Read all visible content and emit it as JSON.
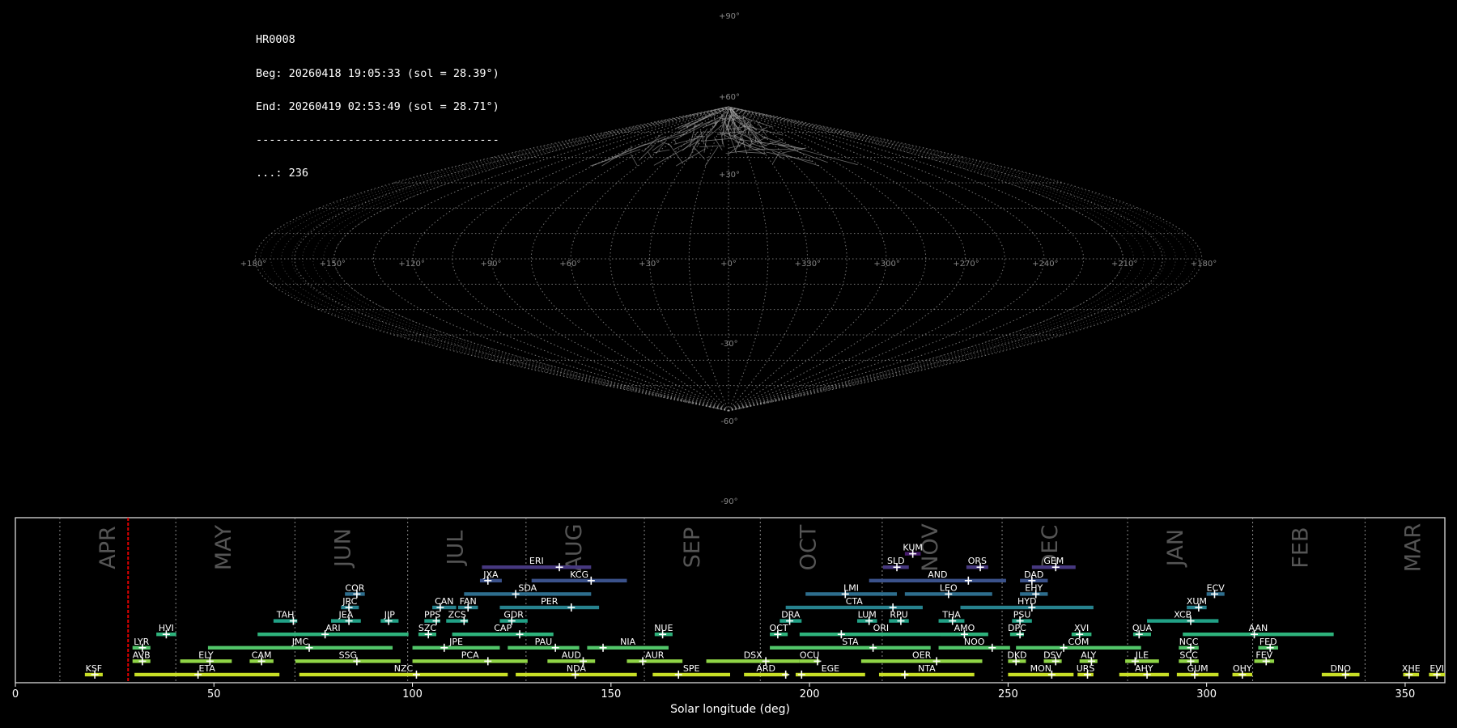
{
  "header": {
    "station": "HR0008",
    "begin": "Beg: 20260418 19:05:33 (sol = 28.39°)",
    "end": "End: 20260419 02:53:49 (sol = 28.71°)",
    "separator": "-------------------------------------",
    "count": "...: 236"
  },
  "sky_map": {
    "projection": "sinusoidal",
    "lon_labels": [
      "+180°",
      "+150°",
      "+120°",
      "+90°",
      "+60°",
      "+30°",
      "+0°",
      "+330°",
      "+300°",
      "+270°",
      "+240°",
      "+210°",
      "+180°"
    ],
    "lat_labels": [
      "+90°",
      "+60°",
      "+30°",
      "-30°",
      "-60°",
      "-90°"
    ],
    "grid_color": "#9a9a9a",
    "meteors_visible": true
  },
  "chart_data": {
    "type": "gantt",
    "xlabel": "Solar longitude (deg)",
    "xlim": [
      0,
      360
    ],
    "xticks": [
      0,
      50,
      100,
      150,
      200,
      250,
      300,
      350
    ],
    "current_sol": 28.39,
    "months": [
      {
        "name": "APR",
        "start": 11.2
      },
      {
        "name": "MAY",
        "start": 40.4
      },
      {
        "name": "JUN",
        "start": 70.4
      },
      {
        "name": "JUL",
        "start": 98.8
      },
      {
        "name": "AUG",
        "start": 128.6
      },
      {
        "name": "SEP",
        "start": 158.4
      },
      {
        "name": "OCT",
        "start": 187.6
      },
      {
        "name": "NOV",
        "start": 218.3
      },
      {
        "name": "DEC",
        "start": 248.5
      },
      {
        "name": "JAN",
        "start": 280.1
      },
      {
        "name": "FEB",
        "start": 311.6
      },
      {
        "name": "MAR",
        "start": 339.9
      }
    ],
    "showers": [
      {
        "code": "KSF",
        "start": 17.5,
        "end": 22,
        "peak": 20,
        "row": 0
      },
      {
        "code": "ETA",
        "start": 30,
        "end": 66.5,
        "peak": 46,
        "row": 0
      },
      {
        "code": "NZC",
        "start": 71.5,
        "end": 124,
        "peak": 101,
        "row": 0
      },
      {
        "code": "NDA",
        "start": 126,
        "end": 156.5,
        "peak": 141,
        "row": 0
      },
      {
        "code": "SPE",
        "start": 160.5,
        "end": 180,
        "peak": 167,
        "row": 0
      },
      {
        "code": "ARD",
        "start": 183.5,
        "end": 194.5,
        "peak": 194,
        "row": 0
      },
      {
        "code": "EGE",
        "start": 196.5,
        "end": 214,
        "peak": 198,
        "row": 0
      },
      {
        "code": "NTA",
        "start": 217.5,
        "end": 241.5,
        "peak": 224,
        "row": 0
      },
      {
        "code": "MON",
        "start": 250,
        "end": 266.5,
        "peak": 261,
        "row": 0
      },
      {
        "code": "URS",
        "start": 267.5,
        "end": 271.5,
        "peak": 270,
        "row": 0
      },
      {
        "code": "AHY",
        "start": 278,
        "end": 290.5,
        "peak": 285,
        "row": 0
      },
      {
        "code": "GUM",
        "start": 292.5,
        "end": 303,
        "peak": 297,
        "row": 0
      },
      {
        "code": "OHY",
        "start": 306.5,
        "end": 311.5,
        "peak": 309,
        "row": 0
      },
      {
        "code": "DNO",
        "start": 329,
        "end": 338.5,
        "peak": 335,
        "row": 0
      },
      {
        "code": "XHE",
        "start": 349.5,
        "end": 353.5,
        "peak": 351,
        "row": 0
      },
      {
        "code": "EVI",
        "start": 356,
        "end": 360,
        "peak": 358,
        "row": 0
      },
      {
        "code": "AVB",
        "start": 29.5,
        "end": 34,
        "peak": 32,
        "row": 1
      },
      {
        "code": "ELY",
        "start": 41.5,
        "end": 54.5,
        "peak": 49,
        "row": 1
      },
      {
        "code": "CAM",
        "start": 59,
        "end": 65,
        "peak": 62,
        "row": 1
      },
      {
        "code": "SSG",
        "start": 70.5,
        "end": 97,
        "peak": 86,
        "row": 1
      },
      {
        "code": "PCA",
        "start": 100,
        "end": 129,
        "peak": 119,
        "row": 1
      },
      {
        "code": "AUD",
        "start": 134,
        "end": 146,
        "peak": 143,
        "row": 1
      },
      {
        "code": "AUR",
        "start": 154,
        "end": 168,
        "peak": 158,
        "row": 1
      },
      {
        "code": "DSX",
        "start": 174,
        "end": 197.5,
        "peak": 189,
        "row": 1
      },
      {
        "code": "OCU",
        "start": 197.5,
        "end": 202.5,
        "peak": 202,
        "row": 1
      },
      {
        "code": "OER",
        "start": 213,
        "end": 243.5,
        "peak": 232,
        "row": 1
      },
      {
        "code": "DKD",
        "start": 250,
        "end": 254.5,
        "peak": 252,
        "row": 1
      },
      {
        "code": "DSV",
        "start": 259,
        "end": 263.5,
        "peak": 262,
        "row": 1
      },
      {
        "code": "ALY",
        "start": 268,
        "end": 272.5,
        "peak": 271,
        "row": 1
      },
      {
        "code": "JLE",
        "start": 279.5,
        "end": 288,
        "peak": 282,
        "row": 1
      },
      {
        "code": "SCC",
        "start": 293,
        "end": 298,
        "peak": 296,
        "row": 1
      },
      {
        "code": "FEV",
        "start": 312,
        "end": 317,
        "peak": 315,
        "row": 1
      },
      {
        "code": "LYR",
        "start": 29.5,
        "end": 34,
        "peak": 32,
        "row": 2
      },
      {
        "code": "JMC",
        "start": 48.5,
        "end": 95,
        "peak": 74,
        "row": 2
      },
      {
        "code": "JPE",
        "start": 100,
        "end": 122,
        "peak": 108,
        "row": 2
      },
      {
        "code": "PAU",
        "start": 124,
        "end": 142,
        "peak": 136,
        "row": 2
      },
      {
        "code": "NIA",
        "start": 144,
        "end": 164.5,
        "peak": 148,
        "row": 2
      },
      {
        "code": "STA",
        "start": 190,
        "end": 230.5,
        "peak": 216,
        "row": 2
      },
      {
        "code": "NOO",
        "start": 232.5,
        "end": 250.5,
        "peak": 246,
        "row": 2
      },
      {
        "code": "COM",
        "start": 252,
        "end": 283.5,
        "peak": 264,
        "row": 2
      },
      {
        "code": "NCC",
        "start": 293,
        "end": 298,
        "peak": 296,
        "row": 2
      },
      {
        "code": "FED",
        "start": 313,
        "end": 318,
        "peak": 316,
        "row": 2
      },
      {
        "code": "HVI",
        "start": 35.5,
        "end": 40.5,
        "peak": 38,
        "row": 3
      },
      {
        "code": "ARI",
        "start": 61,
        "end": 99,
        "peak": 78,
        "row": 3
      },
      {
        "code": "SZC",
        "start": 101.5,
        "end": 106,
        "peak": 104,
        "row": 3
      },
      {
        "code": "CAP",
        "start": 110,
        "end": 135.5,
        "peak": 127,
        "row": 3
      },
      {
        "code": "NUE",
        "start": 161,
        "end": 165.5,
        "peak": 163,
        "row": 3
      },
      {
        "code": "OCT",
        "start": 190,
        "end": 194.5,
        "peak": 192,
        "row": 3
      },
      {
        "code": "ORI",
        "start": 197.5,
        "end": 238.5,
        "peak": 208,
        "row": 3
      },
      {
        "code": "AMO",
        "start": 233,
        "end": 245,
        "peak": 239,
        "row": 3
      },
      {
        "code": "DPC",
        "start": 250.5,
        "end": 254,
        "peak": 253,
        "row": 3
      },
      {
        "code": "XVI",
        "start": 266,
        "end": 271,
        "peak": 268,
        "row": 3
      },
      {
        "code": "QUA",
        "start": 281.5,
        "end": 286,
        "peak": 283,
        "row": 3
      },
      {
        "code": "AAN",
        "start": 294,
        "end": 332,
        "peak": 312,
        "row": 3
      },
      {
        "code": "TAH",
        "start": 65,
        "end": 71,
        "peak": 70,
        "row": 4
      },
      {
        "code": "JEA",
        "start": 79.5,
        "end": 87,
        "peak": 84,
        "row": 4
      },
      {
        "code": "JIP",
        "start": 92,
        "end": 96.5,
        "peak": 94,
        "row": 4
      },
      {
        "code": "PPS",
        "start": 103,
        "end": 107,
        "peak": 106,
        "row": 4
      },
      {
        "code": "ZCS",
        "start": 108.5,
        "end": 114,
        "peak": 113,
        "row": 4
      },
      {
        "code": "GDR",
        "start": 122,
        "end": 129,
        "peak": 125,
        "row": 4
      },
      {
        "code": "DRA",
        "start": 192.5,
        "end": 198,
        "peak": 195,
        "row": 4
      },
      {
        "code": "LUM",
        "start": 212,
        "end": 217,
        "peak": 215,
        "row": 4
      },
      {
        "code": "RPU",
        "start": 220,
        "end": 225,
        "peak": 223,
        "row": 4
      },
      {
        "code": "THA",
        "start": 232.5,
        "end": 239,
        "peak": 236,
        "row": 4
      },
      {
        "code": "PSU",
        "start": 251,
        "end": 256,
        "peak": 253,
        "row": 4
      },
      {
        "code": "XCB",
        "start": 285,
        "end": 303,
        "peak": 296,
        "row": 4
      },
      {
        "code": "JRC",
        "start": 82,
        "end": 86.5,
        "peak": 84,
        "row": 5
      },
      {
        "code": "CAN",
        "start": 105,
        "end": 111,
        "peak": 107,
        "row": 5
      },
      {
        "code": "FAN",
        "start": 111.5,
        "end": 116.5,
        "peak": 114,
        "row": 5
      },
      {
        "code": "PER",
        "start": 122,
        "end": 147,
        "peak": 140,
        "row": 5
      },
      {
        "code": "CTA",
        "start": 194,
        "end": 228.5,
        "peak": 221,
        "row": 5
      },
      {
        "code": "HYD",
        "start": 238,
        "end": 271.5,
        "peak": 256,
        "row": 5
      },
      {
        "code": "XUM",
        "start": 295,
        "end": 300,
        "peak": 298,
        "row": 5
      },
      {
        "code": "COR",
        "start": 83,
        "end": 88,
        "peak": 86,
        "row": 6
      },
      {
        "code": "SDA",
        "start": 113,
        "end": 145,
        "peak": 126,
        "row": 6
      },
      {
        "code": "LMI",
        "start": 199,
        "end": 222,
        "peak": 209,
        "row": 6
      },
      {
        "code": "LEO",
        "start": 224,
        "end": 246,
        "peak": 235,
        "row": 6
      },
      {
        "code": "EHY",
        "start": 253,
        "end": 260,
        "peak": 257,
        "row": 6
      },
      {
        "code": "ECV",
        "start": 300,
        "end": 304.5,
        "peak": 302,
        "row": 6
      },
      {
        "code": "JXA",
        "start": 117,
        "end": 122.5,
        "peak": 119,
        "row": 7
      },
      {
        "code": "KCG",
        "start": 130,
        "end": 154,
        "peak": 145,
        "row": 7
      },
      {
        "code": "AND",
        "start": 215,
        "end": 249.5,
        "peak": 240,
        "row": 7
      },
      {
        "code": "DAD",
        "start": 253,
        "end": 260,
        "peak": 256,
        "row": 7
      },
      {
        "code": "ERI",
        "start": 117.5,
        "end": 145,
        "peak": 137,
        "row": 8
      },
      {
        "code": "SLD",
        "start": 218.5,
        "end": 225,
        "peak": 222,
        "row": 8
      },
      {
        "code": "ORS",
        "start": 239.5,
        "end": 245,
        "peak": 243,
        "row": 8
      },
      {
        "code": "GEM",
        "start": 256,
        "end": 267,
        "peak": 262,
        "row": 8
      },
      {
        "code": "KUM",
        "start": 224,
        "end": 228,
        "peak": 226,
        "row": 9
      }
    ]
  }
}
